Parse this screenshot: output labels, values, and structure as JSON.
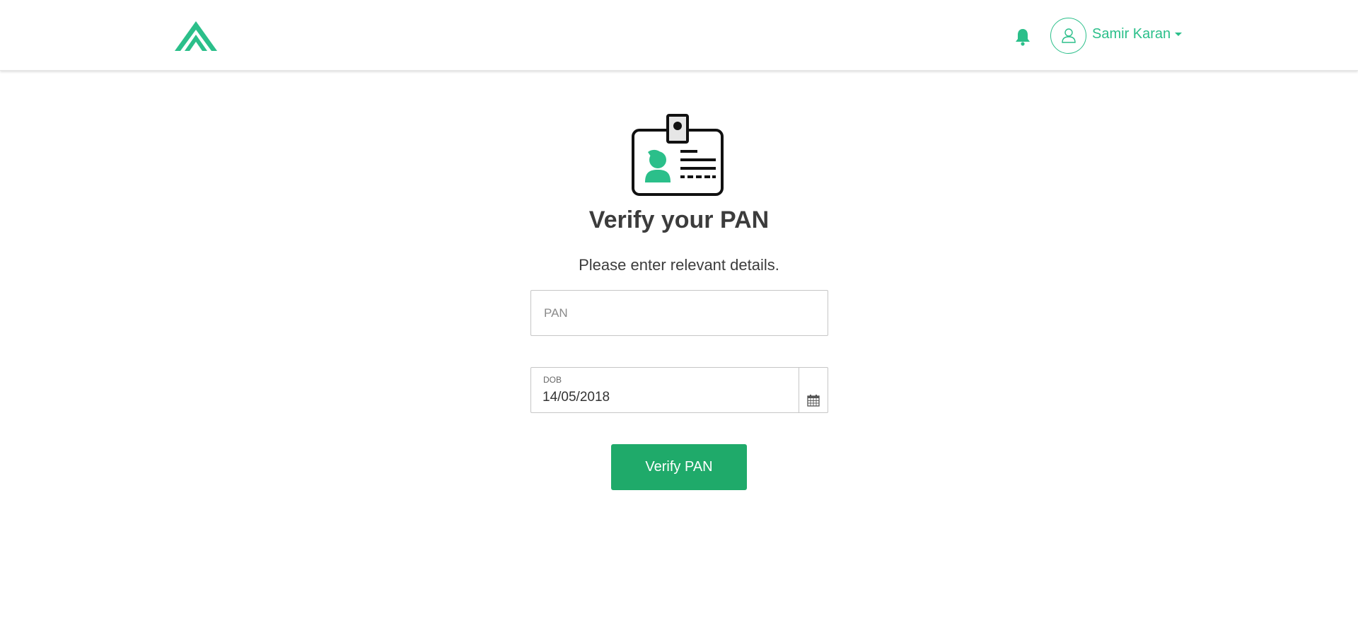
{
  "header": {
    "user_name": "Samir Karan"
  },
  "main": {
    "title": "Verify your PAN",
    "subtitle": "Please enter relevant details.",
    "pan": {
      "placeholder": "PAN",
      "value": ""
    },
    "dob": {
      "label": "DOB",
      "value": "14/05/2018"
    },
    "verify_button_label": "Verify PAN"
  },
  "icons": {
    "logo": "chevron-up-logo",
    "bell": "bell-icon",
    "avatar": "user-icon",
    "caret": "caret-down-icon",
    "illustration": "id-card-icon",
    "calendar": "calendar-icon"
  },
  "colors": {
    "brand": "#2bbf8a",
    "button": "#1faa6a",
    "text": "#3c3c3c"
  }
}
